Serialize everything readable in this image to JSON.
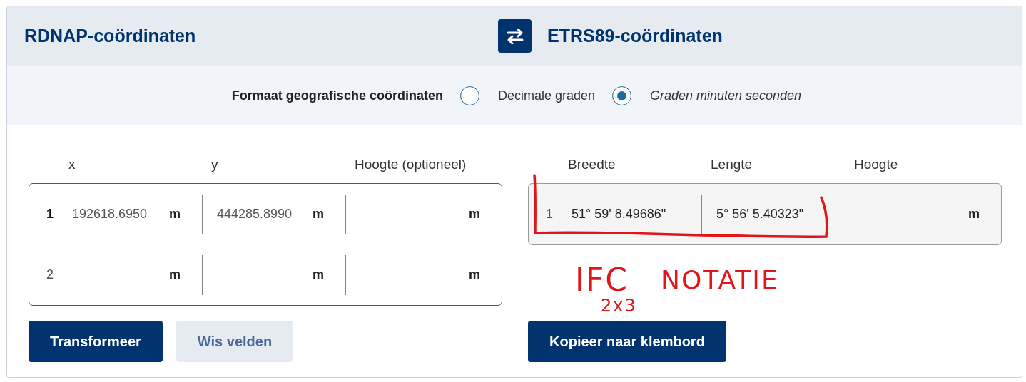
{
  "header": {
    "source_title": "RDNAP-coördinaten",
    "target_title": "ETRS89-coördinaten"
  },
  "format": {
    "label": "Formaat geografische coördinaten",
    "options": [
      {
        "label": "Decimale graden",
        "selected": false
      },
      {
        "label": "Graden minuten seconden",
        "selected": true
      }
    ]
  },
  "input": {
    "columns": [
      "x",
      "y",
      "Hoogte (optioneel)"
    ],
    "rows": [
      {
        "number": "1",
        "cells": [
          {
            "value": "192618.6950",
            "unit": "m"
          },
          {
            "value": "444285.8990",
            "unit": "m"
          },
          {
            "unit": "m"
          }
        ]
      },
      {
        "number": "2",
        "cells": [
          {
            "unit": "m"
          },
          {
            "unit": "m"
          },
          {
            "unit": "m"
          }
        ]
      }
    ],
    "buttons": [
      {
        "label": "Transformeer",
        "kind": "primary"
      },
      {
        "label": "Wis velden",
        "kind": "secondary"
      }
    ]
  },
  "output": {
    "columns": [
      "Breedte",
      "Lengte",
      "Hoogte"
    ],
    "rows": [
      {
        "number": "1",
        "cells": [
          {
            "value": "51° 59' 8.49686\""
          },
          {
            "value": "5° 56' 5.40323\""
          },
          {
            "unit": "m"
          }
        ]
      }
    ],
    "buttons": [
      {
        "label": "Kopieer naar klembord",
        "kind": "primary"
      }
    ]
  },
  "annotation": {
    "main": "IFC",
    "sub": "2x3",
    "word": "NOTATIE"
  }
}
